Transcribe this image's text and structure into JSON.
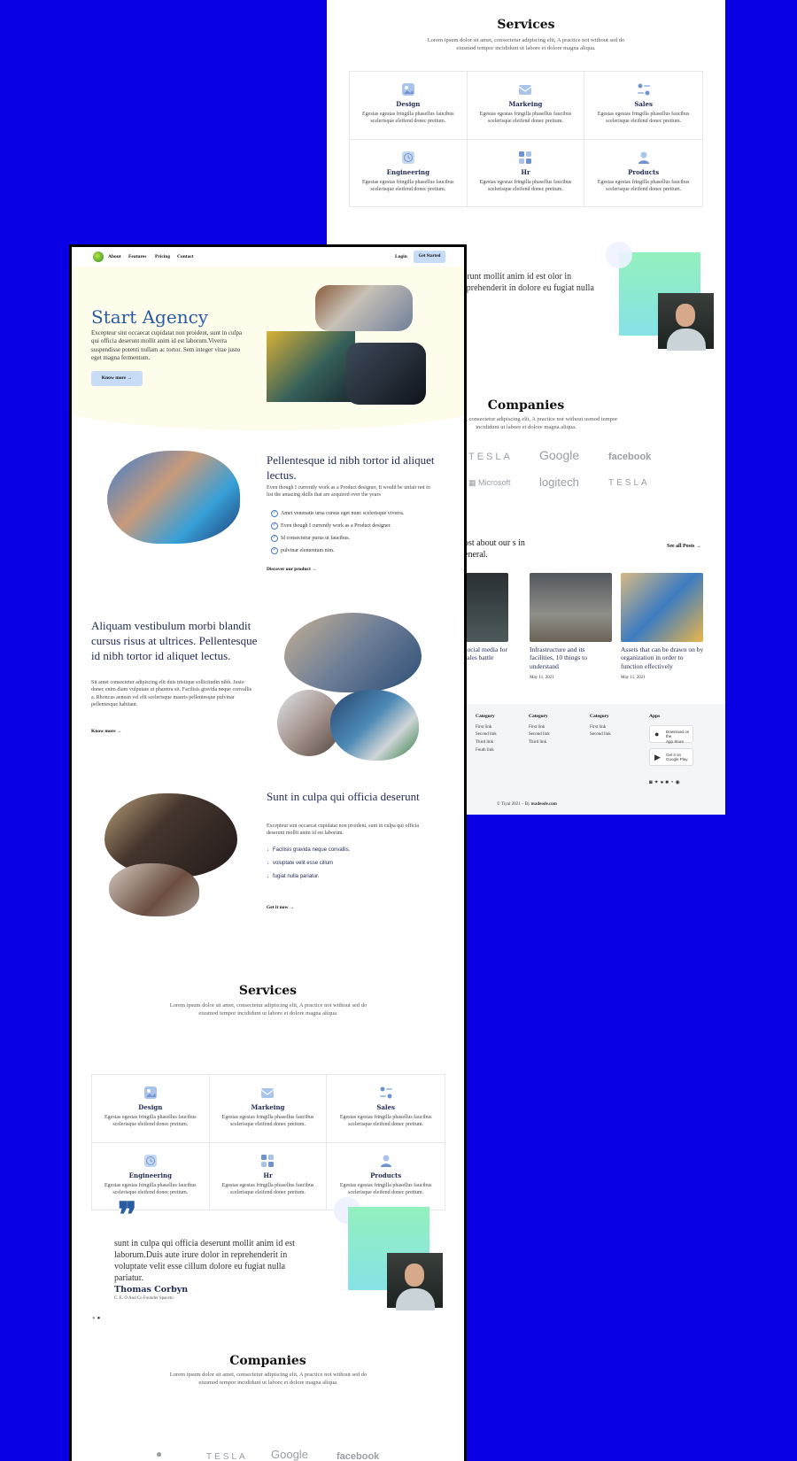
{
  "services_back": {
    "title": "Services",
    "subtitle": "Lorem ipsum dolor sit amet, consectetur adipiscing elit, A practice not without sed do eiusmod tempor incididunt ut labore et dolore magna aliqua.",
    "items": [
      {
        "name": "Design",
        "icon": "image-icon",
        "desc": "Egestas egestas fringilla phasellus faucibus scelerisque eleifend donec pretium."
      },
      {
        "name": "Markeing",
        "icon": "mail-icon",
        "desc": "Egestas egestas fringilla phasellus faucibus scelerisque eleifend donec pretium."
      },
      {
        "name": "Sales",
        "icon": "toggles-icon",
        "desc": "Egestas egestas fringilla phasellus faucibus scelerisque eleifend donec pretium."
      },
      {
        "name": "Engineering",
        "icon": "clock-icon",
        "desc": "Egestas egestas fringilla phasellus faucibus scelerisque eleifend donec pretium."
      },
      {
        "name": "Hr",
        "icon": "grid-icon",
        "desc": "Egestas egestas fringilla phasellus faucibus scelerisque eleifend donec pretium."
      },
      {
        "name": "Products",
        "icon": "user-icon",
        "desc": "Egestas egestas fringilla phasellus faucibus scelerisque eleifend donec pretium."
      }
    ]
  },
  "testimonial_back": {
    "text": "serunt mollit anim id est olor in reprehenderit in dolore eu fugiat nulla"
  },
  "companies_back": {
    "title": "Companies",
    "subtitle": "dolor sit amet, consectetur adipiscing elit, A practice not without usmod tempor incididunt ut labore et dolore magna aliqua.",
    "logos": [
      "TESLA",
      "Google",
      "facebook",
      "Microsoft",
      "logitech",
      "TESLA"
    ]
  },
  "blog_back": {
    "heading": "post about our s in general.",
    "see_all": "See all Posts",
    "posts": [
      {
        "title": "g social media for e sales battle",
        "date": ""
      },
      {
        "title": "Infrastructure and its facilities, 10 things to understand",
        "date": "May 11, 2021"
      },
      {
        "title": "Assets that can be drawn on by organization in order to function effectively",
        "date": "May 11, 2021"
      }
    ]
  },
  "footer_back": {
    "columns": [
      {
        "heading": "Category",
        "links": [
          "First link",
          "Second link",
          "Third link",
          "Fouth link"
        ]
      },
      {
        "heading": "Category",
        "links": [
          "First link",
          "Second link",
          "Third link"
        ]
      },
      {
        "heading": "Category",
        "links": [
          "First link",
          "Second link"
        ]
      }
    ],
    "apps_heading": "Apps",
    "app_store": {
      "top": "Download on the",
      "main": "App Store"
    },
    "google_play": {
      "top": "Get it on",
      "main": "Google Play"
    },
    "social_icons": [
      "instagram-icon",
      "twitter-icon",
      "github-icon",
      "linkedin-icon",
      "rss-icon",
      "pinterest-icon"
    ],
    "copyright": "© Tiyai 2021 – By",
    "credit": "madeode.com"
  },
  "nav": {
    "links": [
      "About",
      "Features",
      "Pricing",
      "Contact"
    ],
    "login": "Login",
    "cta": "Get Started"
  },
  "hero": {
    "title": "Start Agency",
    "desc": "Excepteur sint occaecat cupidatat non proident, sunt in culpa qui officia deserunt mollit anim id est laborum.Viverra suspendisse potenti nullam ac tortor. Sem integer vitae justo eget magna fermentum.",
    "button": "Know more"
  },
  "feature1": {
    "title": "Pellentesque id nibh tortor id aliquet lectus.",
    "desc": "Even though I currently work as a Product designer, It would be unfair not to list the amazing skills that are acquired over the years",
    "checks": [
      "Amet venenatis urna cursus eget nunc scelerisque viverra.",
      "Even though I currently work as a Product designer.",
      "Id consectetur purus ut faucibus.",
      "pulvinar elementum nim."
    ],
    "link": "Discover our product"
  },
  "feature2": {
    "title": "Aliquam vestibulum morbi blandit cursus risus at ultrices. Pellentesque id nibh tortor id aliquet lectus.",
    "desc": "Sit amet consectetur adipiscing elit duis tristique sollicitudin nibh. Justo donec enim diam vulputate ut pharetra sit. Facilisis gravida neque convallis a. Rhoncus aenean vel elit scelerisque mauris pellentesque pulvinar pellentesque habitant.",
    "link": "Know more"
  },
  "feature3": {
    "title": "Sunt in culpa qui officia deserunt",
    "desc": "Excepteur sint occaecat cupidatat non proident, sunt in culpa qui officia deserunt mollit anim id est laborum.",
    "items": [
      "Facilisis gravida neque convallis.",
      "voluptate velit esse cillum",
      "fugiat nulla pariatur."
    ],
    "link": "Get it now"
  },
  "services": {
    "title": "Services",
    "subtitle": "Lorem ipsum dolor sit amet, consectetur adipiscing elit, A practice not without sed do eiusmod tempor incididunt ut labore et dolore magna aliqua.",
    "items": [
      {
        "name": "Design",
        "icon": "image-icon",
        "desc": "Egestas egestas fringilla phasellus faucibus scelerisque eleifend donec pretium."
      },
      {
        "name": "Markeing",
        "icon": "mail-icon",
        "desc": "Egestas egestas fringilla phasellus faucibus scelerisque eleifend donec pretium."
      },
      {
        "name": "Sales",
        "icon": "toggles-icon",
        "desc": "Egestas egestas fringilla phasellus faucibus scelerisque eleifend donec pretium."
      },
      {
        "name": "Engineering",
        "icon": "clock-icon",
        "desc": "Egestas egestas fringilla phasellus faucibus scelerisque eleifend donec pretium."
      },
      {
        "name": "Hr",
        "icon": "grid-icon",
        "desc": "Egestas egestas fringilla phasellus faucibus scelerisque eleifend donec pretium."
      },
      {
        "name": "Products",
        "icon": "user-icon",
        "desc": "Egestas egestas fringilla phasellus faucibus scelerisque eleifend donec pretium."
      }
    ]
  },
  "testimonial": {
    "quote_mark": "❞",
    "text": "sunt in culpa qui officia deserunt mollit anim id est laborum.Duis aute irure dolor in reprehenderit in voluptate velit esse cillum dolore eu fugiat nulla pariatur.",
    "name": "Thomas Corbyn",
    "role": "C. E. O And Co Founder Spaceto"
  },
  "companies": {
    "title": "Companies",
    "subtitle": "Lorem ipsum dolor sit amet, consectetur adipiscing elit, A practice not without sed do eiusmod tempor incididunt ut labore et dolore magna aliqua.",
    "logos": [
      "apple-icon",
      "TESLA",
      "Google",
      "facebook"
    ]
  },
  "colors": {
    "background": "#0a00e6",
    "accent": "#2a5ca4",
    "button": "#c7dcf7",
    "hero_bg": "#fefcea",
    "gradient_top": "#93f0bd",
    "gradient_bottom": "#86e2e6"
  }
}
